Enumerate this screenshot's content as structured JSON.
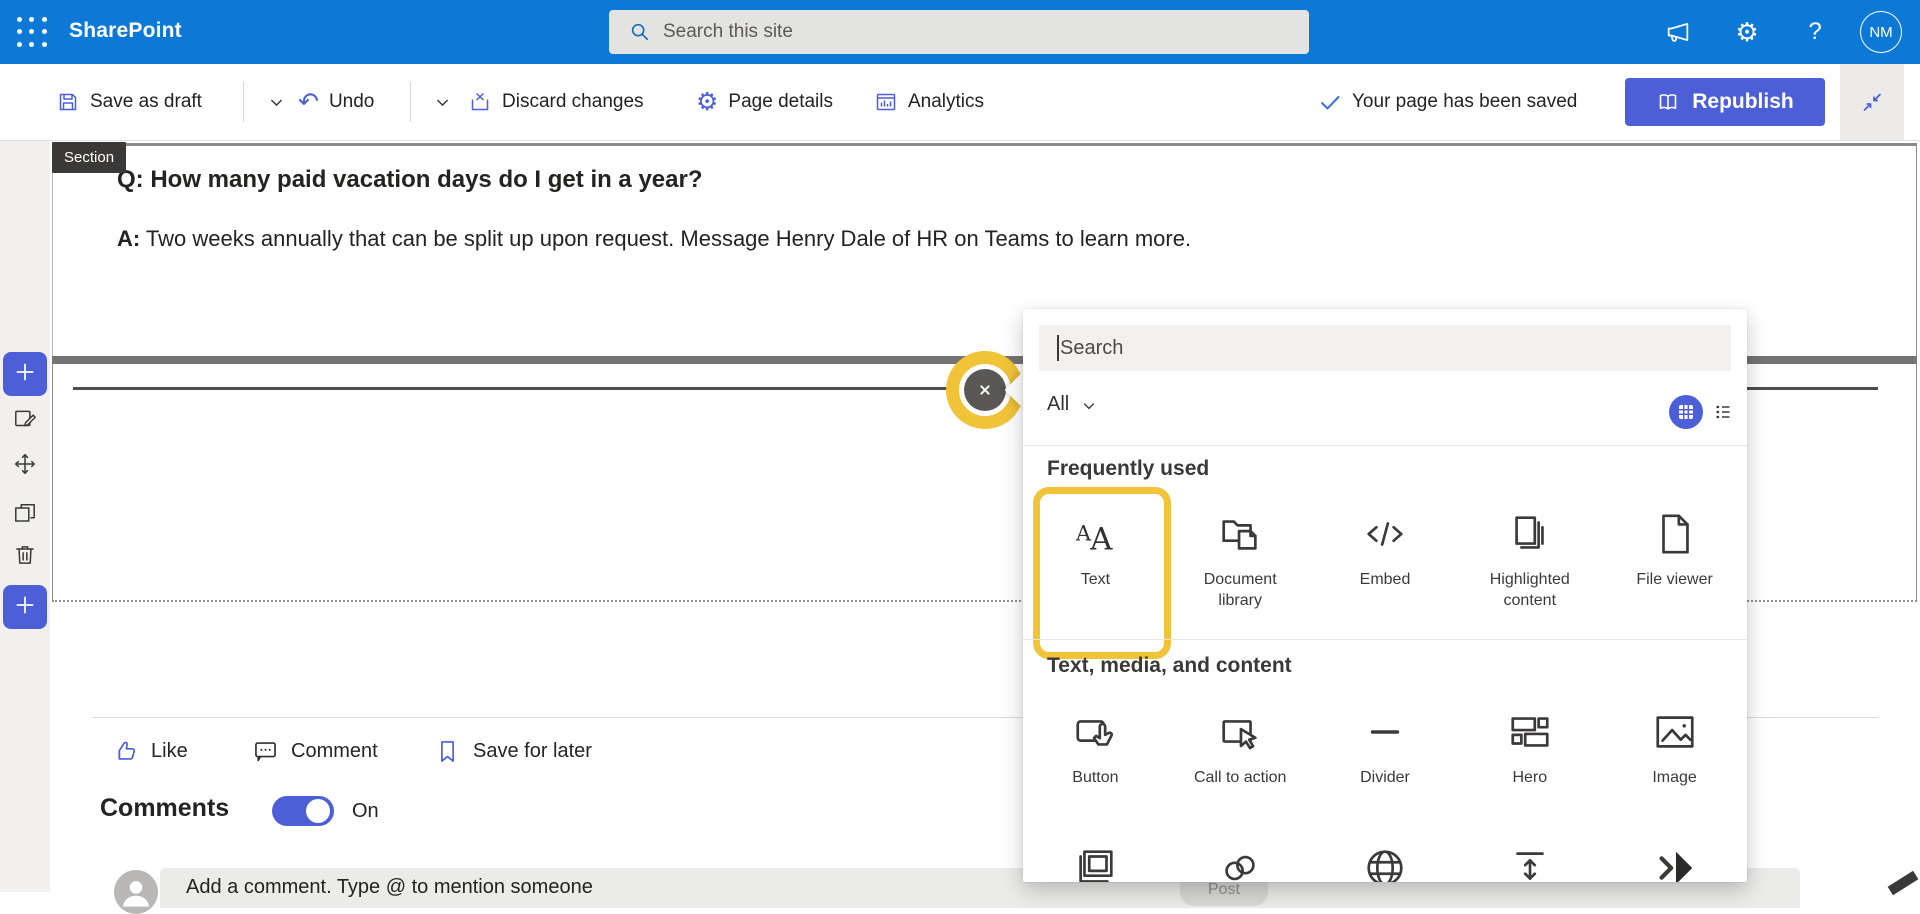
{
  "colors": {
    "suite_blue": "#0c79d6",
    "accent": "#4c5fd7",
    "highlight_yellow": "#f0c338"
  },
  "suite_bar": {
    "app_name": "SharePoint",
    "search_placeholder": "Search this site",
    "avatar_initials": "NM",
    "icons": [
      "waffle-icon",
      "search-icon",
      "megaphone-icon",
      "gear-icon",
      "help-icon"
    ]
  },
  "command_bar": {
    "save_as_draft": "Save as draft",
    "undo": "Undo",
    "discard_changes": "Discard changes",
    "page_details": "Page details",
    "analytics": "Analytics",
    "saved_status": "Your page has been saved",
    "republish": "Republish"
  },
  "left_rail": {
    "items": [
      {
        "icon": "plus-icon",
        "name": "add-web-part-button-top"
      },
      {
        "icon": "edit-icon",
        "name": "edit-section-button"
      },
      {
        "icon": "move-icon",
        "name": "move-section-button"
      },
      {
        "icon": "copy-icon",
        "name": "duplicate-section-button"
      },
      {
        "icon": "trash-icon",
        "name": "delete-section-button"
      },
      {
        "icon": "plus-icon",
        "name": "add-section-button-bottom"
      }
    ]
  },
  "canvas": {
    "section_label": "Section",
    "question_prefix": "Q:",
    "question": " How many paid vacation days do I get in a year?",
    "answer_prefix": "A:",
    "answer": " Two weeks annually that can be split up upon request. Message Henry Dale of HR on Teams to learn more."
  },
  "social_bar": {
    "like": "Like",
    "comment": "Comment",
    "save_for_later": "Save for later"
  },
  "comments": {
    "heading": "Comments",
    "toggle_state": "On",
    "input_placeholder": "Add a comment. Type @ to mention someone",
    "post": "Post"
  },
  "webpart_panel": {
    "search_placeholder": "Search",
    "filter": "All",
    "groups": [
      {
        "title": "Frequently used",
        "items": [
          {
            "label": "Text",
            "icon": "text-icon",
            "highlighted": true
          },
          {
            "label": "Document library",
            "icon": "document-library-icon"
          },
          {
            "label": "Embed",
            "icon": "embed-icon"
          },
          {
            "label": "Highlighted content",
            "icon": "highlighted-content-icon"
          },
          {
            "label": "File viewer",
            "icon": "file-viewer-icon"
          }
        ]
      },
      {
        "title": "Text, media, and content",
        "items": [
          {
            "label": "Button",
            "icon": "button-icon"
          },
          {
            "label": "Call to action",
            "icon": "call-to-action-icon"
          },
          {
            "label": "Divider",
            "icon": "divider-icon"
          },
          {
            "label": "Hero",
            "icon": "hero-icon"
          },
          {
            "label": "Image",
            "icon": "image-icon"
          }
        ]
      }
    ],
    "partial_row_icons": [
      "image-gallery-icon",
      "link-icon",
      "world-icon",
      "spacer-icon",
      "quick-links-icon"
    ]
  }
}
